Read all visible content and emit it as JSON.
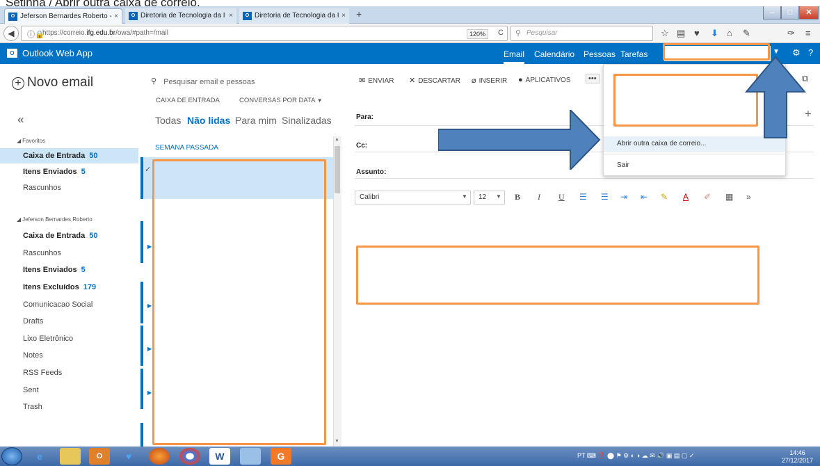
{
  "caption": "Setinha / Abrir outra caixa de correio.",
  "browser": {
    "tabs": [
      {
        "label": "Jeferson Bernardes Roberto -",
        "favicon": "O"
      },
      {
        "label": "Diretoria de Tecnologia da I",
        "favicon": "O"
      },
      {
        "label": "Diretoria de Tecnologia da I",
        "favicon": "O"
      }
    ],
    "url_prefix": "https://correio.",
    "url_domain": "ifg.edu.br",
    "url_path": "/owa/#path=/mail",
    "zoom": "120%",
    "search_placeholder": "Pesquisar"
  },
  "owa": {
    "app_title": "Outlook Web App",
    "nav": [
      "Email",
      "Calendário",
      "Pessoas",
      "Tarefas"
    ]
  },
  "left": {
    "new_mail": "Novo email",
    "collapse": "«",
    "favorites_label": "Favoritos",
    "favorites": [
      {
        "label": "Caixa de Entrada",
        "count": "50"
      },
      {
        "label": "Itens Enviados",
        "count": "5"
      },
      {
        "label": "Rascunhos",
        "count": ""
      }
    ],
    "account_label": "Jeferson Bernardes Roberto",
    "folders": [
      {
        "label": "Caixa de Entrada",
        "count": "50"
      },
      {
        "label": "Rascunhos",
        "count": ""
      },
      {
        "label": "Itens Enviados",
        "count": "5"
      },
      {
        "label": "Itens Excluídos",
        "count": "179"
      },
      {
        "label": "Comunicacao Social",
        "count": ""
      },
      {
        "label": "Drafts",
        "count": ""
      },
      {
        "label": "Lixo Eletrônico",
        "count": ""
      },
      {
        "label": "Notes",
        "count": ""
      },
      {
        "label": "RSS Feeds",
        "count": ""
      },
      {
        "label": "Sent",
        "count": ""
      },
      {
        "label": "Trash",
        "count": ""
      }
    ]
  },
  "middle": {
    "search_placeholder": "Pesquisar email e pessoas",
    "inbox_label": "CAIXA DE ENTRADA",
    "sort_label": "CONVERSAS POR DATA",
    "filters": [
      "Todas",
      "Não lidas",
      "Para mim",
      "Sinalizadas"
    ],
    "week_label": "SEMANA PASSADA"
  },
  "compose": {
    "commands": [
      "ENVIAR",
      "DESCARTAR",
      "INSERIR",
      "APLICATIVOS"
    ],
    "more": "•••",
    "to_label": "Para:",
    "cc_label": "Cc:",
    "subject_label": "Assunto:",
    "font": "Calibri",
    "font_size": "12"
  },
  "menu": {
    "open_other": "Abrir outra caixa de correio...",
    "sign_out": "Sair"
  },
  "taskbar": {
    "lang": "PT",
    "time": "14:46",
    "date": "27/12/2017"
  },
  "colors": {
    "owa_blue": "#0072c6",
    "annotation_orange": "#f79646",
    "annotation_arrow": "#4f81bd"
  }
}
